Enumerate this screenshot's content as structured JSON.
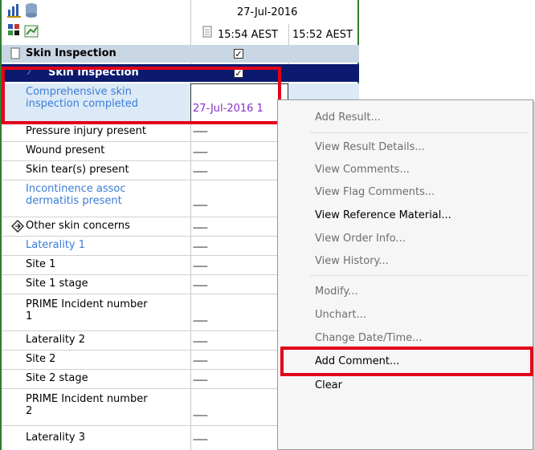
{
  "header": {
    "date": "27-Jul-2016",
    "time1": "15:54 AEST",
    "time2": "15:52 AEST"
  },
  "section": {
    "title": "Skin Inspection",
    "subtitle": "Skin Inspection"
  },
  "rows": [
    {
      "label_line1": "Comprehensive skin",
      "label_line2": "inspection completed",
      "value": "27-Jul-2016 1"
    },
    {
      "label": "Pressure injury present",
      "value": "------"
    },
    {
      "label": "Wound present",
      "value": "------"
    },
    {
      "label": "Skin tear(s) present",
      "value": "------"
    },
    {
      "label_line1": "Incontinence assoc",
      "label_line2": "dermatitis present",
      "value": "------"
    },
    {
      "label": "Other skin concerns",
      "value": "------"
    },
    {
      "label": "Laterality 1",
      "value": "------"
    },
    {
      "label": "Site 1",
      "value": "------"
    },
    {
      "label": "Site 1 stage",
      "value": "------"
    },
    {
      "label_line1": "PRIME Incident number",
      "label_line2": "1",
      "value": "------"
    },
    {
      "label": "Laterality 2",
      "value": "------"
    },
    {
      "label": "Site 2",
      "value": "------"
    },
    {
      "label": "Site 2 stage",
      "value": "------"
    },
    {
      "label_line1": "PRIME Incident number",
      "label_line2": "2",
      "value": "------"
    },
    {
      "label": "Laterality 3",
      "value": "------"
    }
  ],
  "context_menu": {
    "items": [
      "Add Result...",
      "View Result Details...",
      "View Comments...",
      "View Flag Comments...",
      "View Reference Material...",
      "View Order Info...",
      "View History...",
      "Modify...",
      "Unchart...",
      "Change Date/Time...",
      "Add Comment...",
      "Clear"
    ]
  },
  "colors": {
    "grid_border": "#2e7d32",
    "section_bg": "#c9d6e3",
    "selected_bg": "#0b1a6e",
    "highlight_bg": "#dbeaf6",
    "link_text": "#3a7cd8",
    "annotation_red": "#e2001a"
  }
}
